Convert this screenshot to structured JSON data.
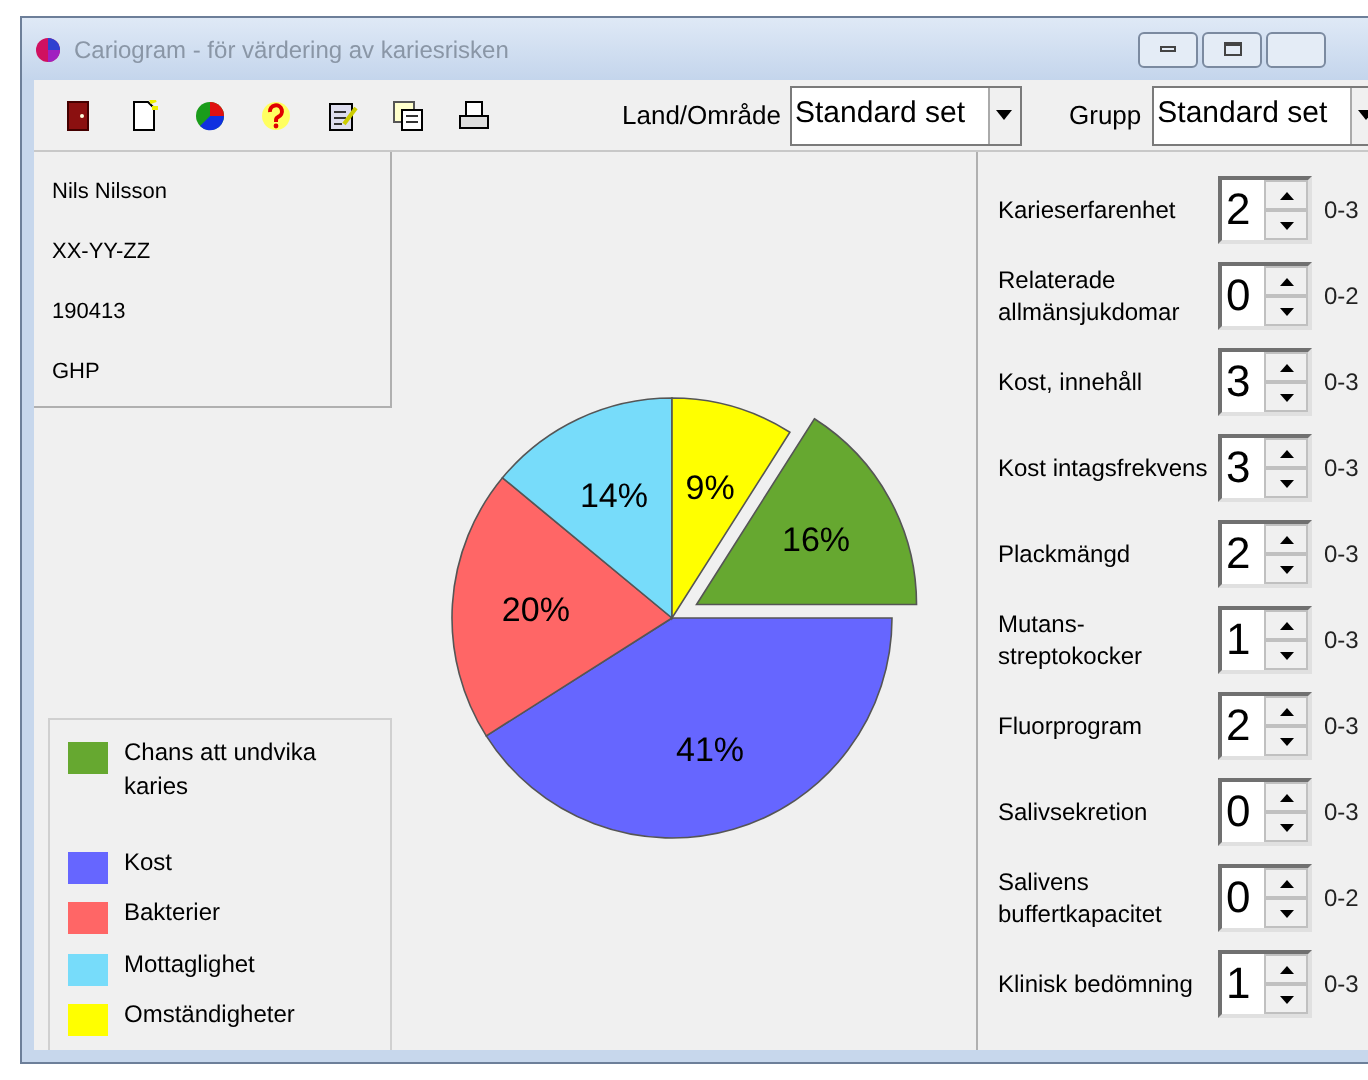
{
  "window": {
    "title": "Cariogram - för värdering av kariesrisken"
  },
  "toolbar": {
    "land_label": "Land/Område",
    "land_value": "Standard set",
    "group_label": "Grupp",
    "group_value": "Standard set"
  },
  "patient": [
    "Nils Nilsson",
    "XX-YY-ZZ",
    "190413",
    "GHP"
  ],
  "chart_data": {
    "type": "pie",
    "categories": [
      "Chans att undvika karies",
      "Kost",
      "Bakterier",
      "Mottaglighet",
      "Omständigheter"
    ],
    "values": [
      16,
      41,
      20,
      14,
      9
    ],
    "value_labels": [
      "16%",
      "41%",
      "20%",
      "14%",
      "9%"
    ]
  },
  "slices": [
    {
      "color": "#66a830",
      "exploded": true
    },
    {
      "color": "#6666ff",
      "exploded": false
    },
    {
      "color": "#ff6666",
      "exploded": false
    },
    {
      "color": "#77dcfa",
      "exploded": false
    },
    {
      "color": "#ffff00",
      "exploded": false
    }
  ],
  "factors": [
    {
      "label": "Karieserfarenhet",
      "value": "2",
      "range": "0-3"
    },
    {
      "label": "Relaterade allmänsjukdomar",
      "value": "0",
      "range": "0-2"
    },
    {
      "label": "Kost, innehåll",
      "value": "3",
      "range": "0-3"
    },
    {
      "label": "Kost intagsfrekvens",
      "value": "3",
      "range": "0-3"
    },
    {
      "label": "Plackmängd",
      "value": "2",
      "range": "0-3"
    },
    {
      "label": "Mutans-streptokocker",
      "value": "1",
      "range": "0-3"
    },
    {
      "label": "Fluorprogram",
      "value": "2",
      "range": "0-3"
    },
    {
      "label": "Salivsekretion",
      "value": "0",
      "range": "0-3"
    },
    {
      "label": "Salivens buffertkapacitet",
      "value": "0",
      "range": "0-2"
    },
    {
      "label": "Klinisk bedömning",
      "value": "1",
      "range": "0-3"
    }
  ]
}
